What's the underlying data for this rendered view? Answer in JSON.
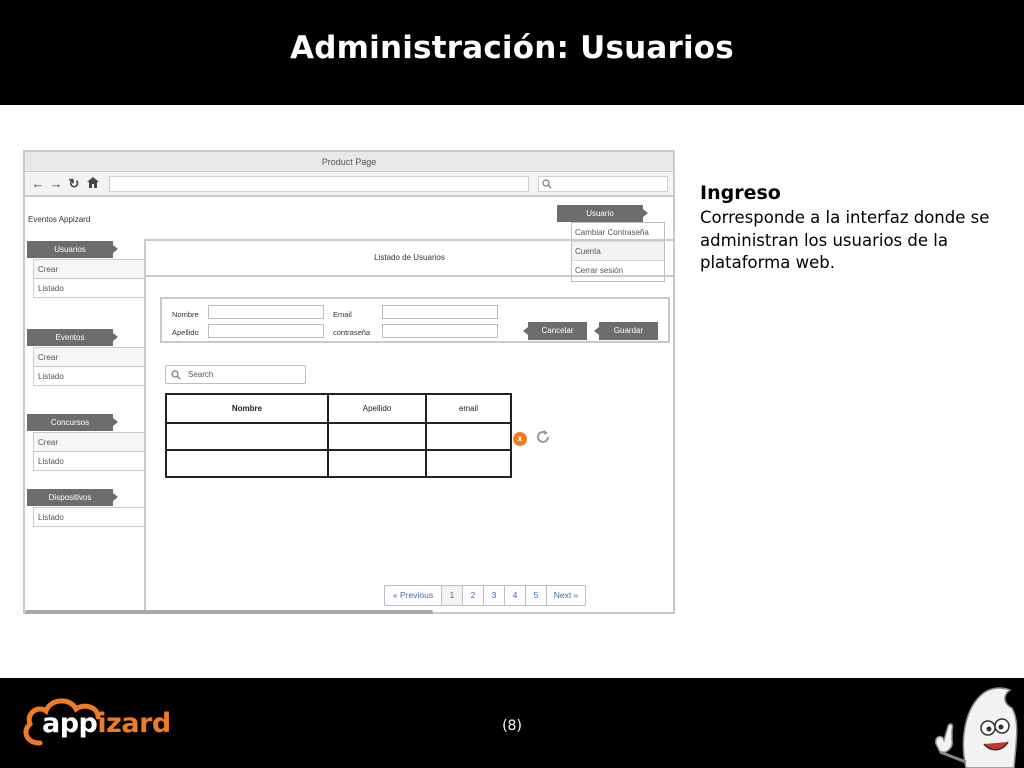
{
  "slide": {
    "title": "Administración: Usuarios",
    "page_number": "(8)",
    "logo": {
      "part1": "app",
      "part2": "izard"
    },
    "colors": {
      "accent": "#f07b22",
      "bar": "#000000"
    }
  },
  "description": {
    "heading": "Ingreso",
    "body": "Corresponde a la interfaz donde se administran los usuarios de la plataforma web."
  },
  "browser": {
    "title": "Product Page",
    "nav_icons": [
      "back-arrow-icon",
      "forward-arrow-icon",
      "refresh-icon",
      "home-icon"
    ]
  },
  "app": {
    "name": "Eventos Appizard",
    "user_menu": {
      "label": "Usuario",
      "items": [
        "Cambiar Contraseña",
        "Cuenta",
        "Cerrar sesión"
      ]
    },
    "sidebar": {
      "sections": [
        {
          "label": "Usuarios",
          "items": [
            "Crear",
            "Listado"
          ]
        },
        {
          "label": "Eventos",
          "items": [
            "Crear",
            "Listado"
          ]
        },
        {
          "label": "Concursos",
          "items": [
            "Crear",
            "Listado"
          ]
        },
        {
          "label": "Dispositivos",
          "items": [
            "Listado"
          ]
        }
      ]
    },
    "content_title": "Listado de Usuarios",
    "form": {
      "nombre_label": "Nombre",
      "apellido_label": "Apellido",
      "email_label": "Email",
      "password_label": "contraseña",
      "cancel_label": "Cancelar",
      "save_label": "Guardar"
    },
    "search": {
      "placeholder": "Search"
    },
    "table": {
      "headers": [
        "Nombre",
        "Apellido",
        "email"
      ],
      "rows": [
        [
          "",
          "",
          ""
        ],
        [
          "",
          "",
          ""
        ]
      ]
    },
    "pagination": {
      "prev": "« Previous",
      "pages": [
        "1",
        "2",
        "3",
        "4",
        "5"
      ],
      "next": "Next »",
      "current": "1"
    }
  }
}
